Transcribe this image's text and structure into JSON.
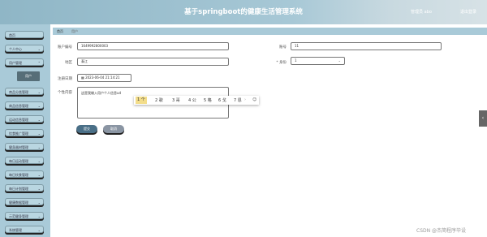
{
  "header": {
    "title": "基于springboot的健康生活管理系统",
    "user": "管理员 abo",
    "logout": "退出登录"
  },
  "sidebar": {
    "items": [
      {
        "label": "首页"
      },
      {
        "label": "个人中心"
      },
      {
        "label": "用户管理"
      },
      {
        "label": "商品分类管理"
      },
      {
        "label": "商品信息管理"
      },
      {
        "label": "运动信息管理"
      },
      {
        "label": "饮食推广管理"
      },
      {
        "label": "健身器材管理"
      },
      {
        "label": "每日运动管理"
      },
      {
        "label": "每日饮食管理"
      },
      {
        "label": "每日计划管理"
      },
      {
        "label": "健康数据管理"
      },
      {
        "label": "示范健身管理"
      },
      {
        "label": "系统管理"
      }
    ],
    "submenu": "用户"
  },
  "breadcrumb": {
    "home": "首页",
    "current": "用户"
  },
  "form": {
    "account_label": "账户编号",
    "account_value": "1649992800003",
    "name_label": "账号",
    "name_value": "11",
    "region_label": "地区",
    "region_value": "泰江",
    "role_label": "* 身份",
    "role_value": "1",
    "date_label": "注册日期",
    "date_value": "2023-06-04 21:14:21",
    "content_label": "个性内容",
    "content_value": "这是我输入用户个人信息ud"
  },
  "ime": {
    "candidates": [
      "1 个",
      "2 歌",
      "3 哥",
      "4 公",
      "5 格",
      "6 戈",
      "7 恩"
    ],
    "prev": "‹",
    "next": "›",
    "emoji": "☺"
  },
  "buttons": {
    "submit": "提交",
    "cancel": "取消"
  },
  "side_tab": "‹",
  "watermark": "CSDN @杰简程序毕设"
}
